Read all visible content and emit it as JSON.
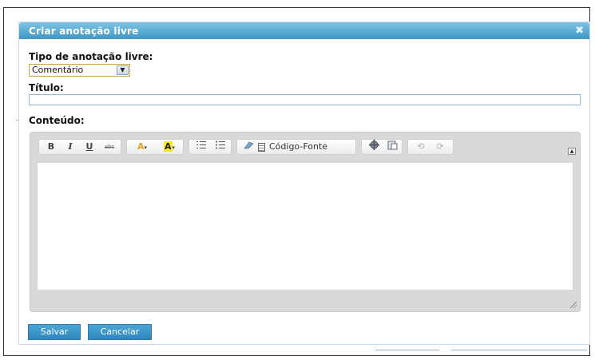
{
  "dialog": {
    "title": "Criar anotação livre",
    "close_icon": "close-icon",
    "type_label": "Tipo de anotação livre:",
    "type_value": "Comentário",
    "title_label": "Título:",
    "title_value": "",
    "content_label": "Conteúdo:",
    "content_value": "",
    "save_label": "Salvar",
    "cancel_label": "Cancelar"
  },
  "toolbar": {
    "bold": "B",
    "italic": "I",
    "underline": "U",
    "strike": "abc",
    "font_color": "A",
    "bg_color": "A",
    "source_label": "Código-Fonte",
    "icons": [
      "bold-icon",
      "italic-icon",
      "underline-icon",
      "strike-icon",
      "font-color-icon",
      "highlight-color-icon",
      "ordered-list-icon",
      "bullet-list-icon",
      "eraser-icon",
      "source-code-icon",
      "plugin-icon",
      "paste-icon",
      "undo-icon",
      "redo-icon",
      "maximize-icon"
    ]
  },
  "colors": {
    "titlebar_top": "#7fc3e4",
    "titlebar_bottom": "#3f97c7",
    "button": "#3a96cb",
    "font_color_icon": "#e6a31f",
    "highlight_icon": "#f5e71b"
  }
}
